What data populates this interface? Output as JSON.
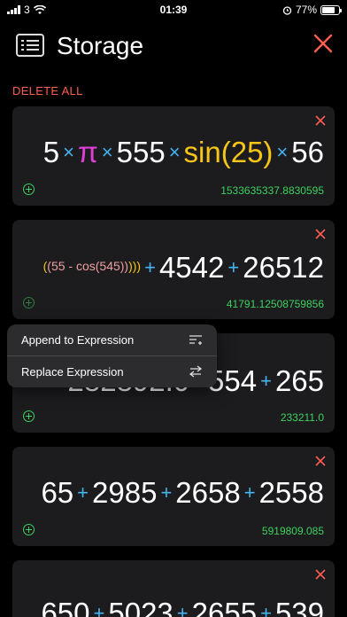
{
  "status": {
    "carrier_num": "3",
    "time": "01:39",
    "battery": "77%"
  },
  "header": {
    "title": "Storage"
  },
  "actions": {
    "delete_all": "DELETE ALL"
  },
  "cards": [
    {
      "expr": {
        "p1": "5",
        "p2": "π",
        "p3": "555",
        "p4": "sin(25)",
        "p5": "56"
      },
      "result": "1533635337.8830595"
    },
    {
      "expr": {
        "nest_a": "(",
        "nest_b": "(55 - cos(545))",
        "nest_c": ")))",
        "n1": "4542",
        "n2": "26512"
      },
      "result": "41791.12508759856"
    },
    {
      "expr": {
        "n1": "282892.0",
        "n2": "554",
        "n3": "265"
      },
      "result": "233211.0"
    },
    {
      "expr": {
        "n1": "65",
        "n2": "2985",
        "n3": "2658",
        "n4": "2558"
      },
      "result": "5919809.085"
    },
    {
      "expr": {
        "n1": "650",
        "n2": "5023",
        "n3": "2655",
        "n4": "539"
      },
      "result": ""
    }
  ],
  "context_menu": {
    "append": "Append to Expression",
    "replace": "Replace Expression"
  },
  "colors": {
    "accent_red": "#ff5e52",
    "accent_green": "#3dd160",
    "op_blue": "#45b3f5"
  }
}
